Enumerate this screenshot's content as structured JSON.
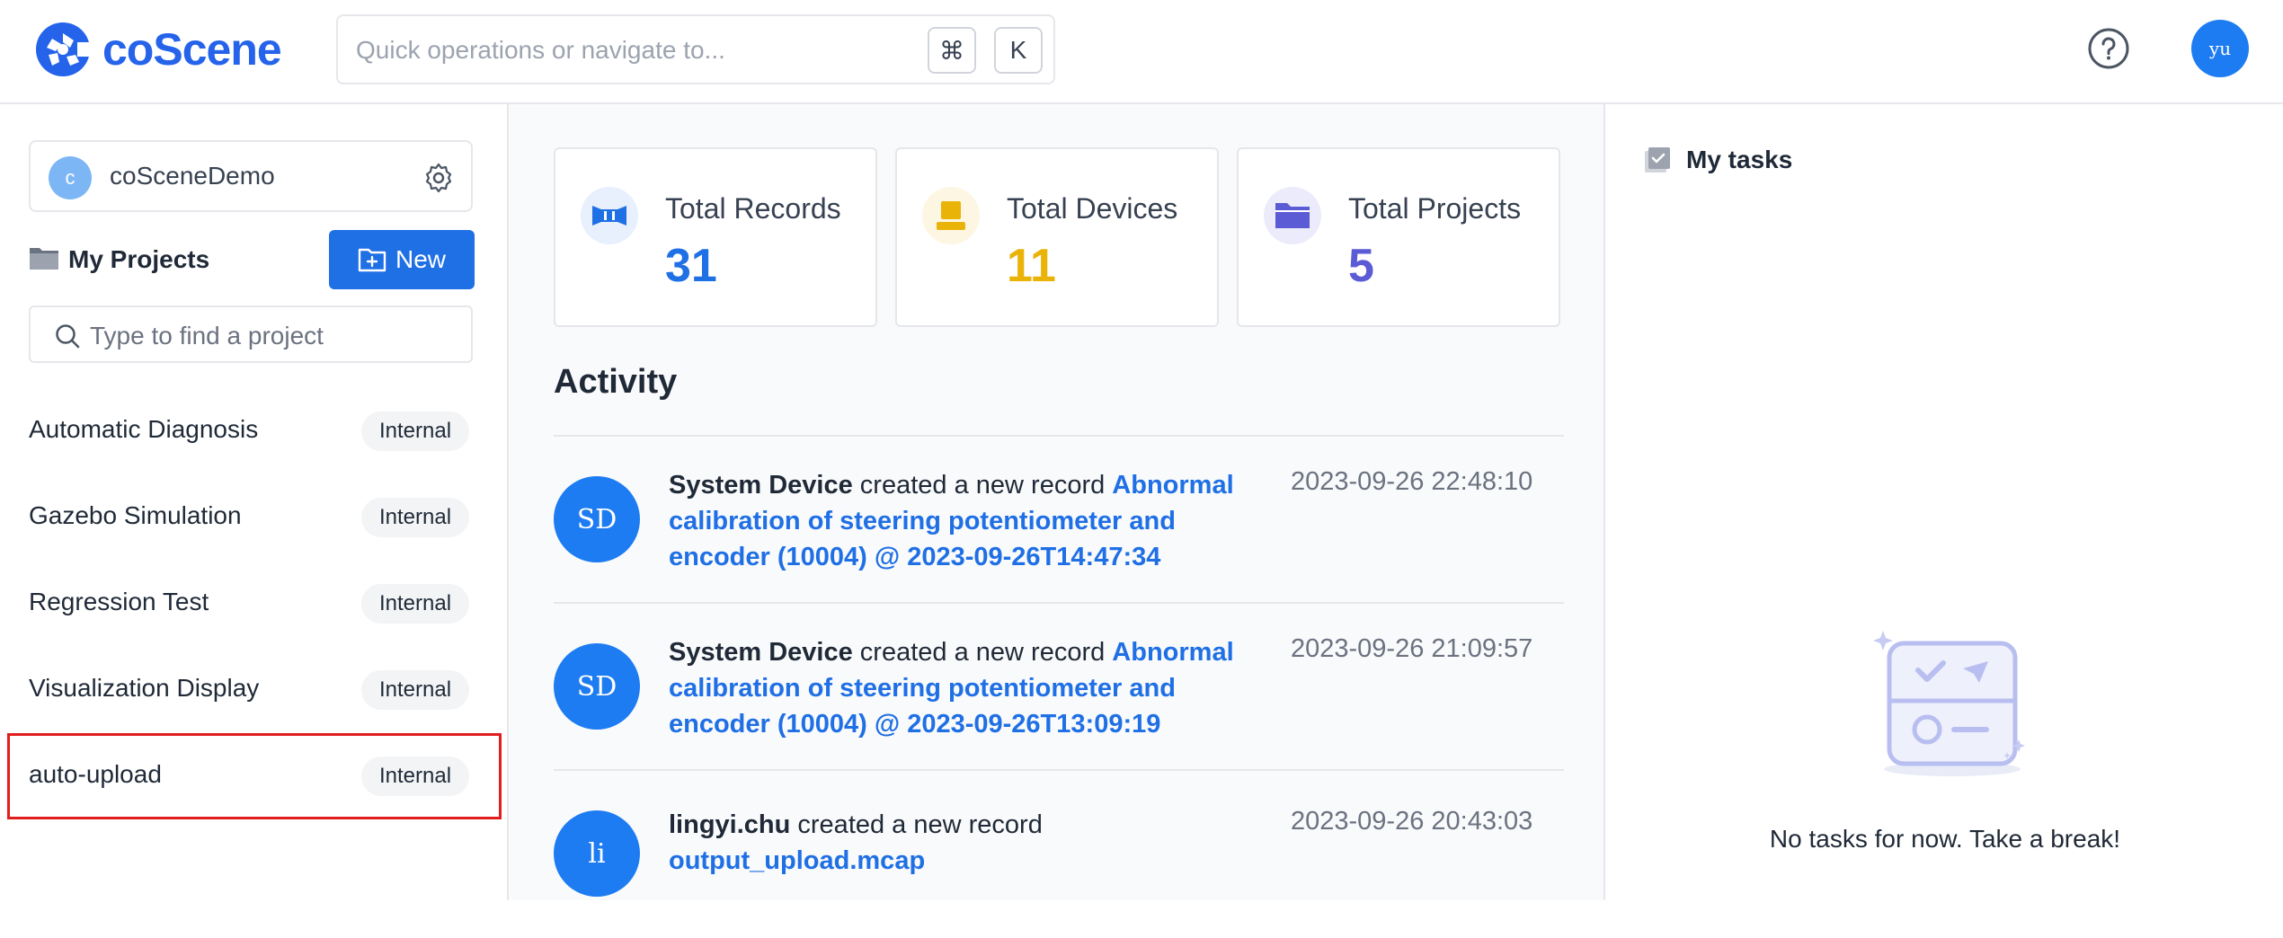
{
  "app": {
    "logo_text": "coScene",
    "brand_color": "#2563eb"
  },
  "header": {
    "search_placeholder": "Quick operations or navigate to...",
    "shortcut_cmd": "⌘",
    "shortcut_key": "K",
    "user_initials": "yu"
  },
  "sidebar": {
    "org": {
      "initial": "c",
      "name": "coSceneDemo"
    },
    "projects_title": "My Projects",
    "new_button": "New",
    "project_search_placeholder": "Type to find a project",
    "projects": [
      {
        "name": "Automatic Diagnosis",
        "visibility": "Internal"
      },
      {
        "name": "Gazebo Simulation",
        "visibility": "Internal"
      },
      {
        "name": "Regression Test",
        "visibility": "Internal"
      },
      {
        "name": "Visualization Display",
        "visibility": "Internal"
      },
      {
        "name": "auto-upload",
        "visibility": "Internal"
      }
    ]
  },
  "stats": [
    {
      "label": "Total Records",
      "value": "31",
      "color": "#1f6fe5"
    },
    {
      "label": "Total Devices",
      "value": "11",
      "color": "#eab308"
    },
    {
      "label": "Total Projects",
      "value": "5",
      "color": "#5b5bd6"
    }
  ],
  "activity": {
    "title": "Activity",
    "items": [
      {
        "avatar": "SD",
        "actor": "System Device",
        "action": " created a new record ",
        "record": "Abnormal calibration of steering potentiometer and encoder (10004) @ 2023-09-26T14:47:34",
        "time": "2023-09-26 22:48:10"
      },
      {
        "avatar": "SD",
        "actor": "System Device",
        "action": " created a new record ",
        "record": "Abnormal calibration of steering potentiometer and encoder (10004) @ 2023-09-26T13:09:19",
        "time": "2023-09-26 21:09:57"
      },
      {
        "avatar": "li",
        "actor": "lingyi.chu",
        "action": " created a new record ",
        "record": "output_upload.mcap",
        "time": "2023-09-26 20:43:03"
      }
    ]
  },
  "tasks": {
    "title": "My tasks",
    "empty_text": "No tasks for now. Take a break!"
  }
}
